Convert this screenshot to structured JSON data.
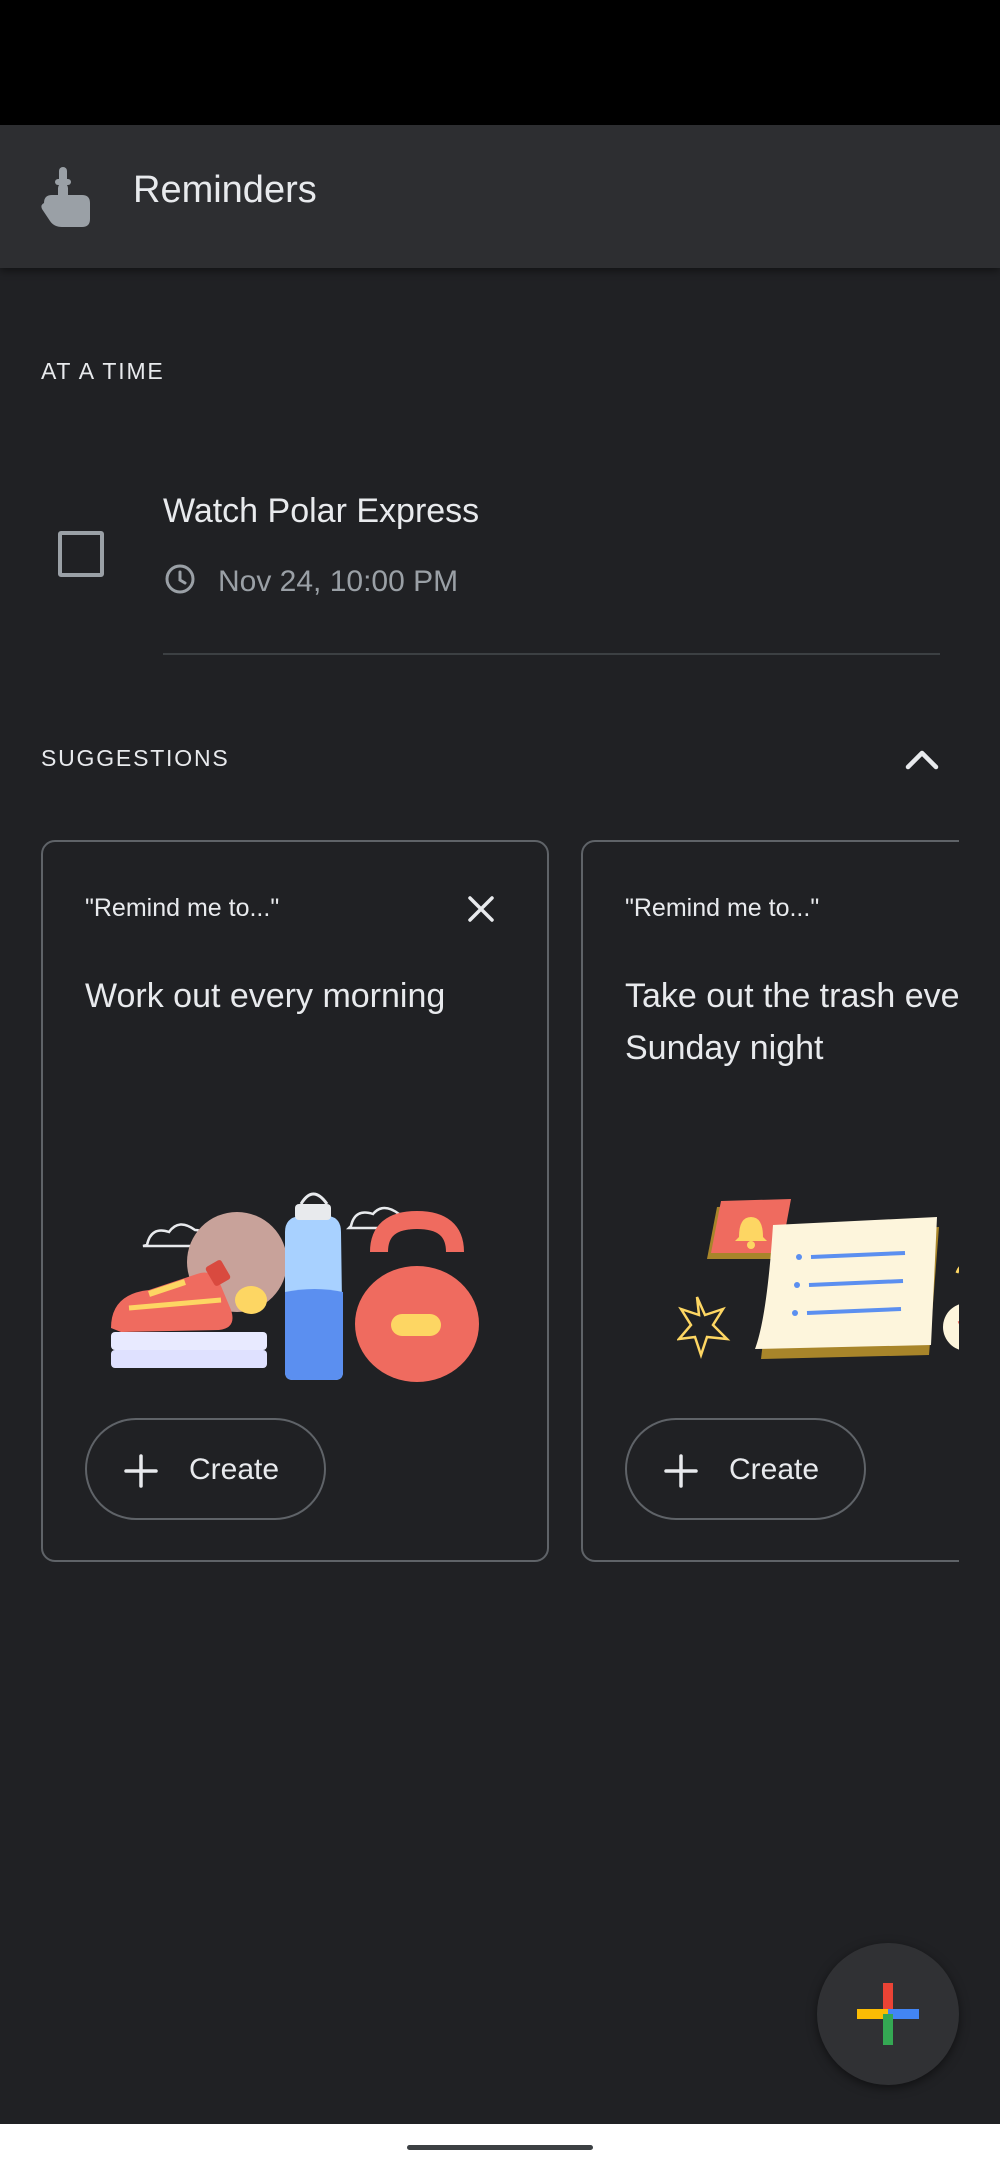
{
  "app_bar": {
    "title": "Reminders",
    "icon": "pointing-hand-icon"
  },
  "sections": {
    "at_a_time": "AT A TIME",
    "suggestions": "SUGGESTIONS"
  },
  "reminder": {
    "title": "Watch Polar Express",
    "time": "Nov 24, 10:00 PM",
    "checked": false
  },
  "suggestion_cards": [
    {
      "pretitle": "\"Remind me to...\"",
      "title_line1": "Work out every morning",
      "title_line2": "",
      "button_label": "Create",
      "illustration": "workout-illustration"
    },
    {
      "pretitle": "\"Remind me to...\"",
      "title_line1": "Take out the trash every",
      "title_line2": "Sunday night",
      "button_label": "Create",
      "illustration": "trash-schedule-illustration"
    }
  ],
  "fab": {
    "icon": "colored-plus-icon"
  },
  "colors": {
    "background": "#202124",
    "app_bar": "#2d2e31",
    "text": "#e8eaed",
    "secondary_text": "#9aa0a6",
    "plus_red": "#ea4335",
    "plus_blue": "#4285f4",
    "plus_yellow": "#fbbc04",
    "plus_green": "#34a853"
  }
}
